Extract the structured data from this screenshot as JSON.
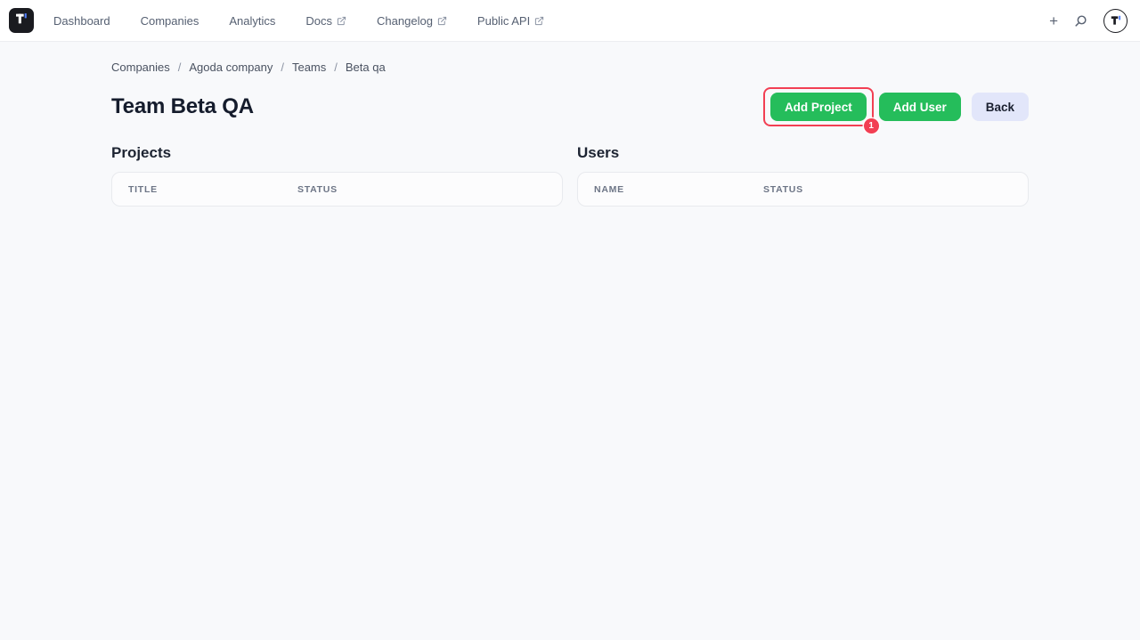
{
  "nav": {
    "logo_alt": "T",
    "items": [
      {
        "label": "Dashboard",
        "external": false
      },
      {
        "label": "Companies",
        "external": false
      },
      {
        "label": "Analytics",
        "external": false
      },
      {
        "label": "Docs",
        "external": true
      },
      {
        "label": "Changelog",
        "external": true
      },
      {
        "label": "Public API",
        "external": true
      }
    ],
    "plus_glyph": "+"
  },
  "breadcrumb": {
    "separator": "/",
    "items": [
      "Companies",
      "Agoda company",
      "Teams",
      "Beta qa"
    ]
  },
  "page": {
    "title": "Team Beta QA"
  },
  "toolbar": {
    "add_project_label": "Add Project",
    "add_user_label": "Add User",
    "back_label": "Back"
  },
  "annotation": {
    "badge_label": "1"
  },
  "sections": {
    "projects": {
      "heading": "Projects",
      "columns": [
        "TITLE",
        "STATUS"
      ],
      "rows": []
    },
    "users": {
      "heading": "Users",
      "columns": [
        "NAME",
        "STATUS"
      ],
      "rows": []
    }
  },
  "colors": {
    "primary_green": "#25bd5b",
    "back_button_bg": "#e2e6fa",
    "annotation_red": "#f23f53",
    "page_bg": "#f8f9fb"
  }
}
